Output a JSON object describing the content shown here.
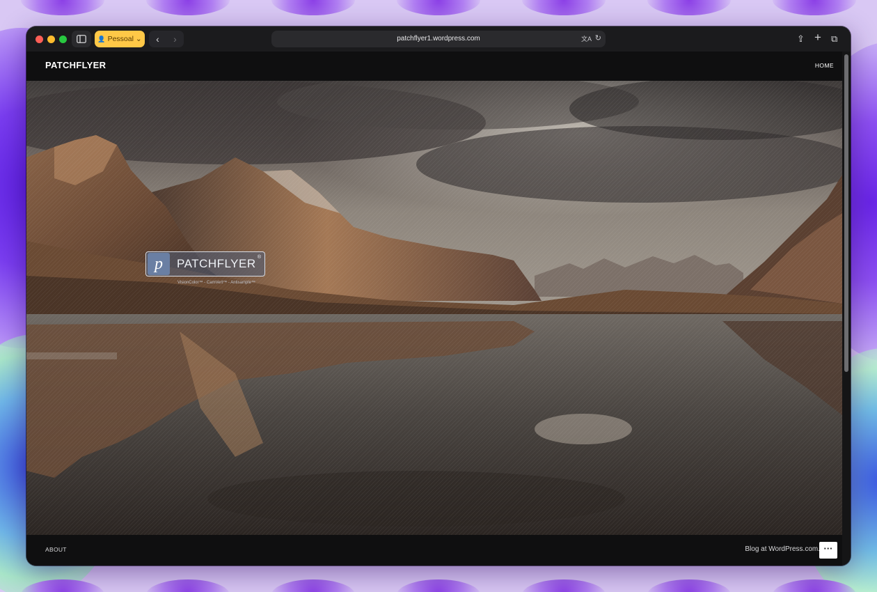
{
  "browser": {
    "profile_label": "Pessoal",
    "url": "patchflyer1.wordpress.com",
    "icons": [
      "sidebar-icon",
      "back-icon",
      "forward-icon",
      "translate-icon",
      "reload-icon",
      "share-icon",
      "new-tab-icon",
      "tab-overview-icon"
    ]
  },
  "site": {
    "title": "PATCHFLYER",
    "nav": {
      "home": "HOME"
    },
    "hero": {
      "logo_letter": "p",
      "logo_text": "PATCHFLYER",
      "logo_reg": "®",
      "logo_subtitle": "VisionColor™ - CamVert™ - Antisample™"
    },
    "footer": {
      "about": "ABOUT",
      "credit": "Blog at WordPress.com.",
      "more": "···"
    }
  },
  "colors": {
    "traffic_red": "#fe5f57",
    "traffic_yellow": "#febc2e",
    "traffic_green": "#28c840",
    "profile_accent": "#ffc847",
    "page_bg": "#0f0f10"
  }
}
